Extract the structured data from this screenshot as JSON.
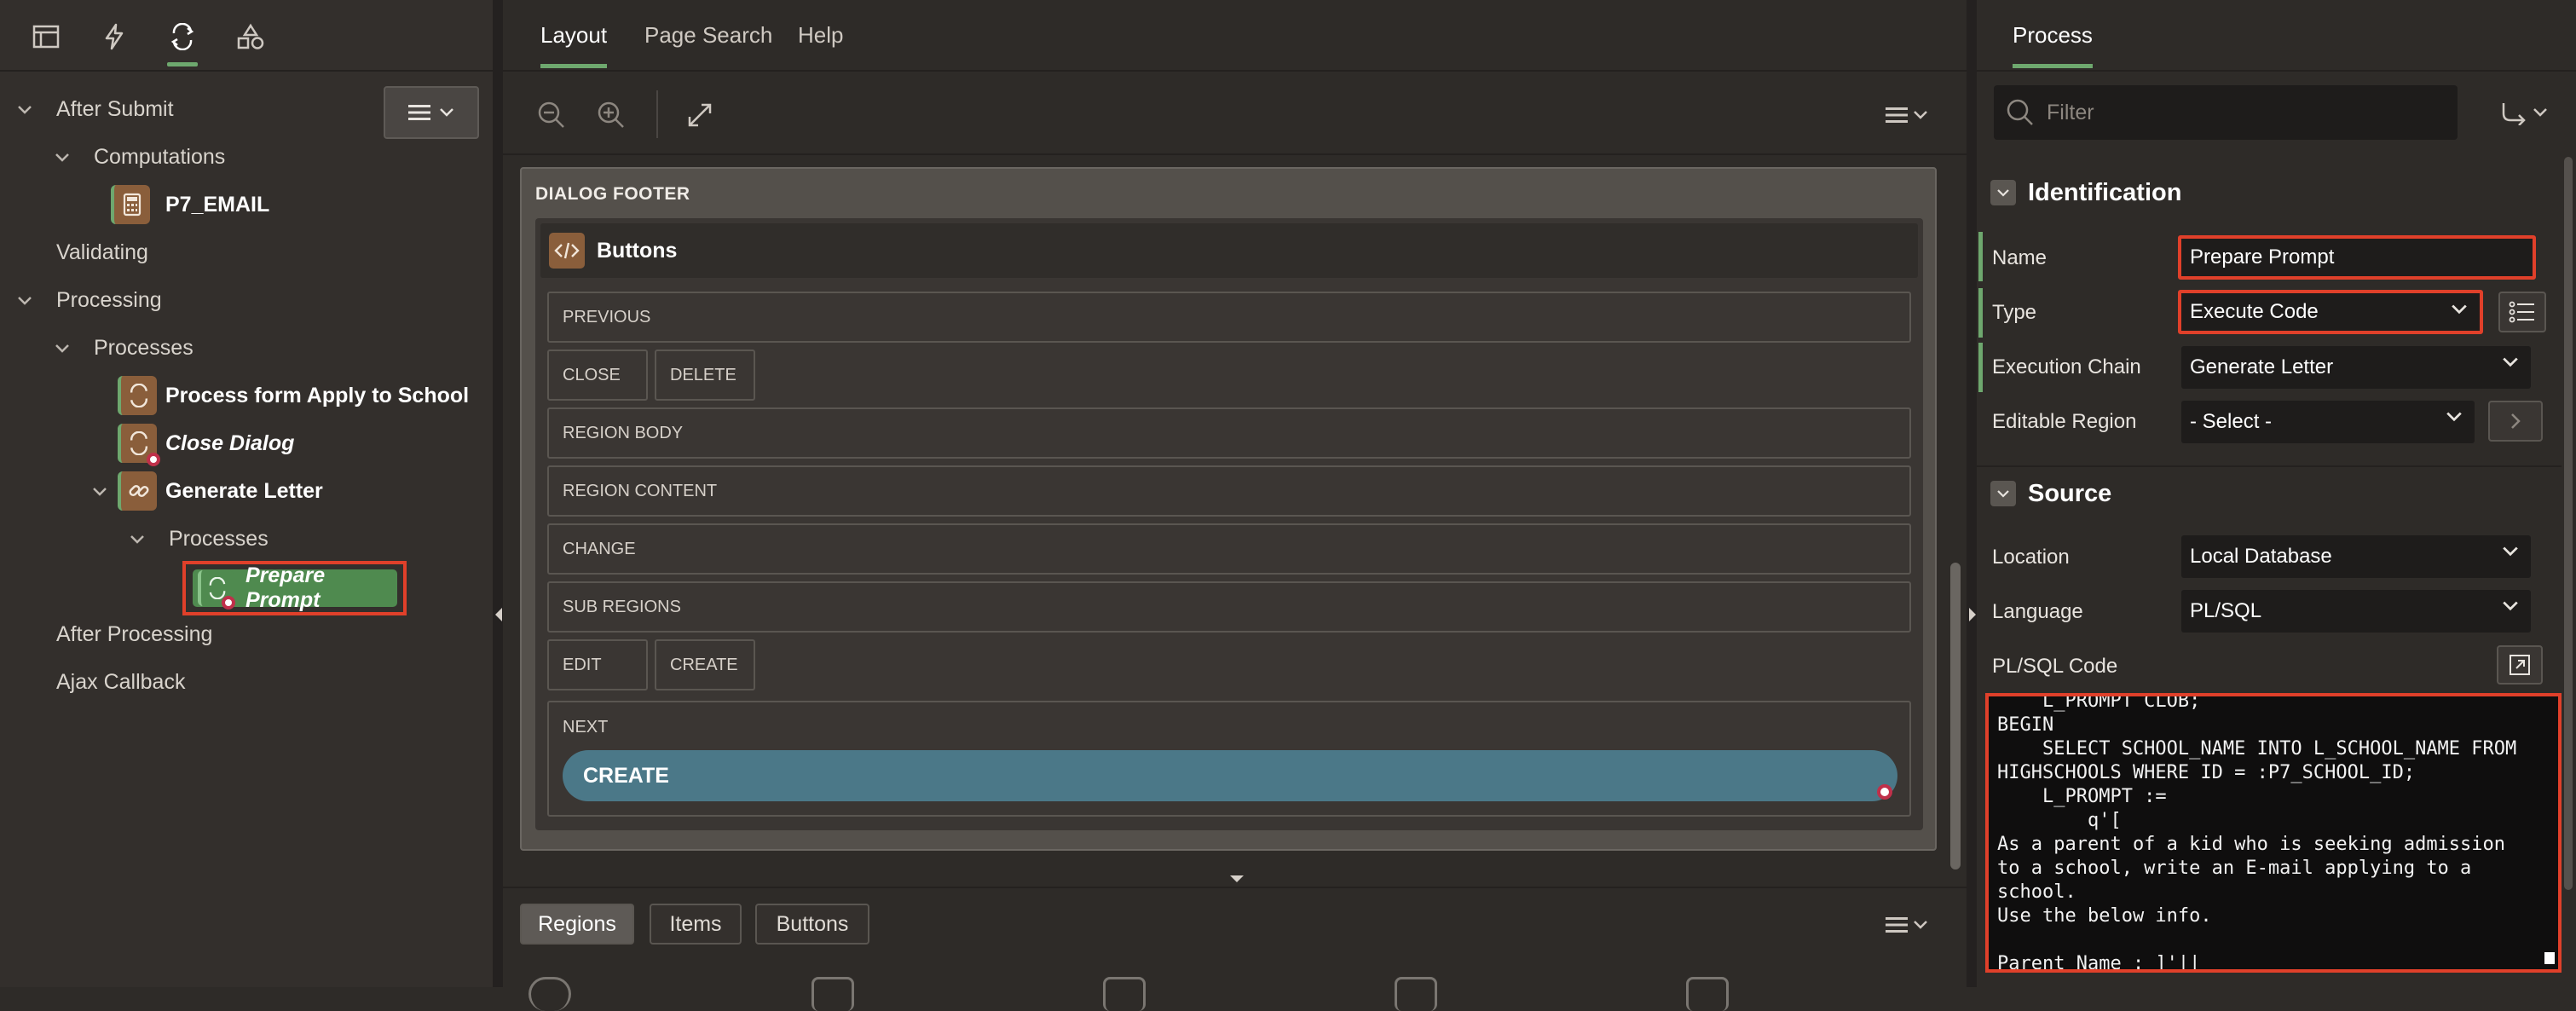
{
  "left_panel": {
    "tree": {
      "after_submit": "After Submit",
      "computations": "Computations",
      "p7_email": "P7_EMAIL",
      "validating": "Validating",
      "processing": "Processing",
      "processes": "Processes",
      "process_form": "Process form Apply to School",
      "close_dialog": "Close Dialog",
      "generate_letter": "Generate Letter",
      "sub_processes": "Processes",
      "prepare_prompt": "Prepare Prompt",
      "after_processing": "After Processing",
      "ajax_callback": "Ajax Callback"
    }
  },
  "center_panel": {
    "tabs": [
      "Layout",
      "Page Search",
      "Help"
    ],
    "dialog_footer_label": "DIALOG FOOTER",
    "buttons_region_title": "Buttons",
    "slots": {
      "previous": "PREVIOUS",
      "close": "CLOSE",
      "delete": "DELETE",
      "region_body": "REGION BODY",
      "region_content": "REGION CONTENT",
      "change": "CHANGE",
      "sub_regions": "SUB REGIONS",
      "edit": "EDIT",
      "create": "CREATE",
      "next": "NEXT"
    },
    "create_button": "CREATE",
    "bottom_tabs": [
      "Regions",
      "Items",
      "Buttons"
    ]
  },
  "right_panel": {
    "tab": "Process",
    "filter_placeholder": "Filter",
    "identification": {
      "title": "Identification",
      "name_label": "Name",
      "name_value": "Prepare Prompt",
      "type_label": "Type",
      "type_value": "Execute Code",
      "execution_chain_label": "Execution Chain",
      "execution_chain_value": "Generate Letter",
      "editable_region_label": "Editable Region",
      "editable_region_value": "- Select -"
    },
    "source": {
      "title": "Source",
      "location_label": "Location",
      "location_value": "Local Database",
      "language_label": "Language",
      "language_value": "PL/SQL",
      "code_label": "PL/SQL Code",
      "code": "    L_PROMPT CLOB;\nBEGIN\n    SELECT SCHOOL_NAME INTO L_SCHOOL_NAME FROM\nHIGHSCHOOLS WHERE ID = :P7_SCHOOL_ID;\n    L_PROMPT :=\n        q'[\nAs a parent of a kid who is seeking admission\nto a school, write an E-mail applying to a\nschool.\nUse the below info.\n\nParent Name : ]'||"
    }
  },
  "colors": {
    "accent_green": "#6ea86e",
    "highlight_red": "#e0402a",
    "component_brown": "#8a5e3b",
    "create_button_teal": "#4b7888"
  }
}
